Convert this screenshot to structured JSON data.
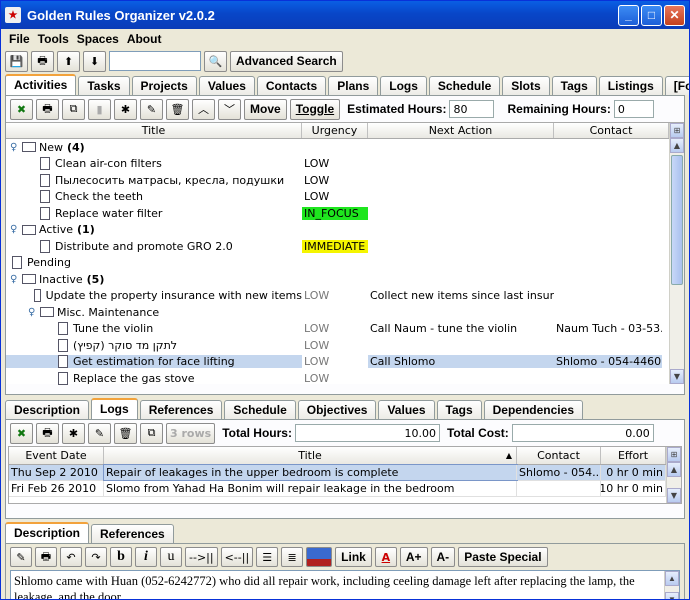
{
  "window": {
    "title": "Golden Rules Organizer v2.0.2"
  },
  "menu": [
    "File",
    "Tools",
    "Spaces",
    "About"
  ],
  "toolbar": {
    "search_placeholder": "",
    "advanced_search": "Advanced Search"
  },
  "main_tabs": [
    "Activities",
    "Tasks",
    "Projects",
    "Values",
    "Contacts",
    "Plans",
    "Logs",
    "Schedule",
    "Slots",
    "Tags",
    "Listings",
    "[Found]"
  ],
  "activities_toolbar": {
    "move": "Move",
    "toggle": "Toggle",
    "est_label": "Estimated Hours:",
    "est_value": "80",
    "rem_label": "Remaining Hours:",
    "rem_value": "0"
  },
  "columns": {
    "title": "Title",
    "urgency": "Urgency",
    "next_action": "Next Action",
    "contact": "Contact"
  },
  "tree": [
    {
      "level": 0,
      "type": "folder",
      "expander": "⚲",
      "label": "New",
      "count": "(4)"
    },
    {
      "level": 1,
      "type": "doc",
      "label": "Clean air-con filters",
      "urgency": "LOW"
    },
    {
      "level": 1,
      "type": "doc",
      "label": "Пылесосить матрасы, кресла, подушки",
      "urgency": "LOW"
    },
    {
      "level": 1,
      "type": "doc",
      "label": "Check the teeth",
      "urgency": "LOW"
    },
    {
      "level": 1,
      "type": "doc",
      "label": "Replace water filter",
      "urgency": "IN_FOCUS",
      "hl": "green"
    },
    {
      "level": 0,
      "type": "folder",
      "label": "Active",
      "count": "(1)"
    },
    {
      "level": 1,
      "type": "doc",
      "label": "Distribute and promote GRO 2.0",
      "urgency": "IMMEDIATE",
      "hl": "yellow"
    },
    {
      "level": 0,
      "type": "doc",
      "label": "Pending"
    },
    {
      "level": 0,
      "type": "folder",
      "label": "Inactive",
      "count": "(5)"
    },
    {
      "level": 1,
      "type": "doc",
      "label": "Update the property insurance with new items",
      "urgency": "LOW",
      "gray": true,
      "next": "Collect new items since last insura..."
    },
    {
      "level": 1,
      "type": "folder",
      "label": "Misc. Maintenance"
    },
    {
      "level": 2,
      "type": "doc",
      "label": "Tune the violin",
      "urgency": "LOW",
      "gray": true,
      "next": "Call Naum - tune the violin",
      "contact": "Naum Tuch - 03-53..."
    },
    {
      "level": 2,
      "type": "doc",
      "label": "לתקן מד סוקר (קפיץ)",
      "urgency": "LOW",
      "gray": true
    },
    {
      "level": 2,
      "type": "doc",
      "label": "Get estimation for face lifting",
      "urgency": "LOW",
      "gray": true,
      "next": "Call Shlomo",
      "contact": "Shlomo - 054-4460...",
      "selected": true
    },
    {
      "level": 2,
      "type": "doc",
      "label": "Replace the gas stove",
      "urgency": "LOW",
      "gray": true
    }
  ],
  "detail_tabs": [
    "Description",
    "Logs",
    "References",
    "Schedule",
    "Objectives",
    "Values",
    "Tags",
    "Dependencies"
  ],
  "logs_toolbar": {
    "rows": "3 rows",
    "total_hours_label": "Total Hours:",
    "total_hours": "10.00",
    "total_cost_label": "Total Cost:",
    "total_cost": "0.00"
  },
  "log_columns": {
    "date": "Event Date",
    "title": "Title",
    "contact": "Contact",
    "effort": "Effort"
  },
  "logs": [
    {
      "date": "Thu Sep 2 2010",
      "title": "Repair of leakages in the upper bedroom is complete",
      "contact": "Shlomo - 054...",
      "effort": "0 hr 0 min",
      "selected": true
    },
    {
      "date": "Fri Feb 26 2010",
      "title": "Slomo from Yahad Ha Bonim will repair leakage in the bedroom",
      "contact": "",
      "effort": "10 hr 0 min"
    }
  ],
  "desc_tabs": [
    "Description",
    "References"
  ],
  "editor": {
    "link": "Link",
    "a_plus": "A+",
    "a_minus": "A-",
    "paste": "Paste Special",
    "indent": "-->||",
    "outdent": "<--||"
  },
  "description_text": "Shlomo came with Huan (052-6242772) who did all repair work, including ceeling damage left after replacing the lamp, the leakage, and the door."
}
